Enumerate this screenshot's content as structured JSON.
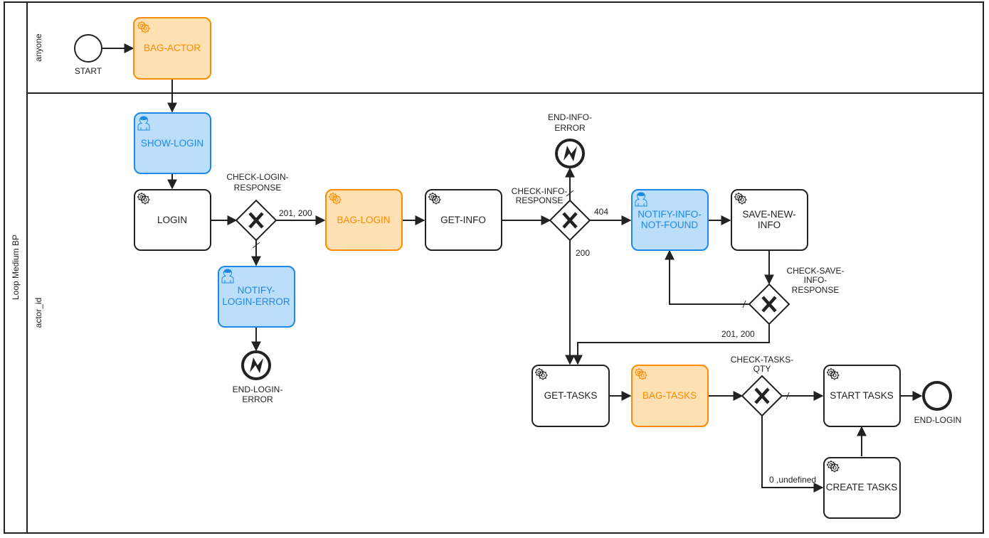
{
  "pool": {
    "label": "Loop Medium BP"
  },
  "lanes": [
    {
      "id": "anyone",
      "label": "anyone"
    },
    {
      "id": "actor_id",
      "label": "actor_id"
    }
  ],
  "colors": {
    "service_fill": "#ffffff",
    "service_stroke": "#222222",
    "service_text": "#222222",
    "bag_fill": "#ffe0b2",
    "bag_stroke": "#fb8c00",
    "bag_text": "#fb8c00",
    "user_fill": "#bbdefb",
    "user_stroke": "#1e88e5",
    "user_text": "#1e88e5"
  },
  "nodes": {
    "start": {
      "label": "START",
      "type": "start-event"
    },
    "bag_actor": {
      "label": "BAG-ACTOR",
      "type": "service-task",
      "style": "bag"
    },
    "show_login": {
      "label": "SHOW-LOGIN",
      "type": "user-task",
      "style": "user"
    },
    "login": {
      "label": "LOGIN",
      "type": "service-task",
      "style": "service"
    },
    "check_login": {
      "label1": "CHECK-LOGIN-",
      "label2": "RESPONSE",
      "type": "exclusive-gateway"
    },
    "notify_login_error": {
      "label1": "NOTIFY-",
      "label2": "LOGIN-ERROR",
      "type": "user-task",
      "style": "user"
    },
    "end_login_error": {
      "label1": "END-LOGIN-",
      "label2": "ERROR",
      "type": "error-end-event"
    },
    "bag_login": {
      "label": "BAG-LOGIN",
      "type": "service-task",
      "style": "bag"
    },
    "get_info": {
      "label": "GET-INFO",
      "type": "service-task",
      "style": "service"
    },
    "check_info": {
      "label1": "CHECK-INFO-",
      "label2": "RESPONSE",
      "type": "exclusive-gateway"
    },
    "end_info_error": {
      "label1": "END-INFO-",
      "label2": "ERROR",
      "type": "error-end-event"
    },
    "notify_info_not_found": {
      "label1": "NOTIFY-INFO-",
      "label2": "NOT-FOUND",
      "type": "user-task",
      "style": "user"
    },
    "save_new_info": {
      "label1": "SAVE-NEW-",
      "label2": "INFO",
      "type": "service-task",
      "style": "service"
    },
    "check_save_info": {
      "label1": "CHECK-SAVE-",
      "label2": "INFO-",
      "label3": "RESPONSE",
      "type": "exclusive-gateway"
    },
    "get_tasks": {
      "label": "GET-TASKS",
      "type": "service-task",
      "style": "service"
    },
    "bag_tasks": {
      "label": "BAG-TASKS",
      "type": "service-task",
      "style": "bag"
    },
    "check_tasks_qty": {
      "label1": "CHECK-TASKS-",
      "label2": "QTY",
      "type": "exclusive-gateway"
    },
    "start_tasks": {
      "label": "START TASKS",
      "type": "service-task",
      "style": "service"
    },
    "create_tasks": {
      "label": "CREATE TASKS",
      "type": "service-task",
      "style": "service"
    },
    "end_login": {
      "label": "END-LOGIN",
      "type": "end-event"
    }
  },
  "edge_labels": {
    "login_ok": "201, 200",
    "info_404": "404",
    "info_200": "200",
    "save_ok": "201, 200",
    "tasks_empty": "0 ,undefined"
  }
}
